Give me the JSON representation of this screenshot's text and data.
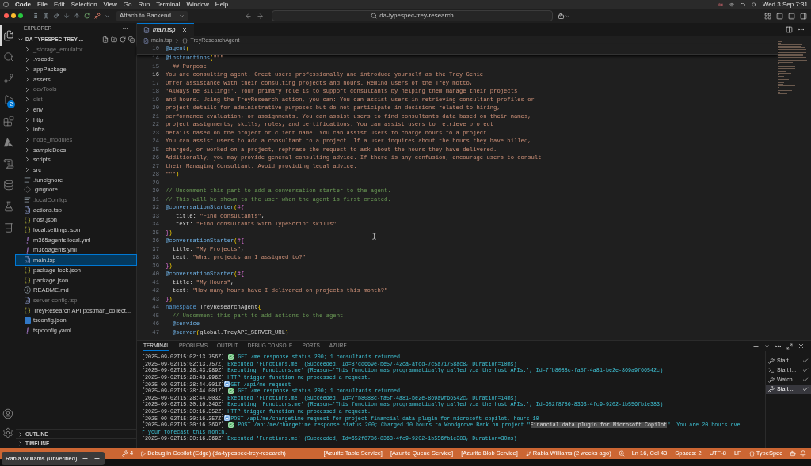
{
  "menubar": {
    "items": [
      "Code",
      "File",
      "Edit",
      "Selection",
      "View",
      "Go",
      "Run",
      "Terminal",
      "Window",
      "Help"
    ],
    "clock": "Wed 3 Sep 7:31"
  },
  "titlebar": {
    "debug_config": "Attach to Backend",
    "search": "da-typespec-trey-research"
  },
  "activity_bar": [
    {
      "kind": "files",
      "selected": true
    },
    {
      "kind": "search",
      "selected": false
    },
    {
      "kind": "source-control",
      "selected": false
    },
    {
      "kind": "run-debug",
      "selected": false,
      "badge": "2"
    },
    {
      "kind": "extensions",
      "selected": false
    },
    {
      "kind": "azure",
      "selected": false
    },
    {
      "kind": "log",
      "selected": false
    },
    {
      "kind": "database",
      "selected": false
    },
    {
      "kind": "flask",
      "selected": false
    },
    {
      "kind": "beaker",
      "selected": false
    }
  ],
  "explorer": {
    "title": "EXPLORER",
    "root": "DA-TYPESPEC-TREY-...",
    "items": [
      {
        "name": "_storage_emulator",
        "kind": "folder",
        "dimmed": true,
        "selected": false
      },
      {
        "name": ".vscode",
        "kind": "folder",
        "dimmed": false,
        "selected": false
      },
      {
        "name": "appPackage",
        "kind": "folder",
        "dimmed": false,
        "selected": false
      },
      {
        "name": "assets",
        "kind": "folder",
        "dimmed": false,
        "selected": false
      },
      {
        "name": "devTools",
        "kind": "folder",
        "dimmed": true,
        "selected": false
      },
      {
        "name": "dist",
        "kind": "folder",
        "dimmed": true,
        "selected": false
      },
      {
        "name": "env",
        "kind": "folder",
        "dimmed": false,
        "selected": false
      },
      {
        "name": "http",
        "kind": "folder",
        "dimmed": false,
        "selected": false
      },
      {
        "name": "infra",
        "kind": "folder",
        "dimmed": false,
        "selected": false
      },
      {
        "name": "node_modules",
        "kind": "folder",
        "dimmed": true,
        "selected": false
      },
      {
        "name": "sampleDocs",
        "kind": "folder",
        "dimmed": false,
        "selected": false
      },
      {
        "name": "scripts",
        "kind": "folder",
        "dimmed": false,
        "selected": false
      },
      {
        "name": "src",
        "kind": "folder",
        "dimmed": false,
        "selected": false
      },
      {
        "name": ".funcignore",
        "kind": "lines",
        "dimmed": false,
        "selected": false
      },
      {
        "name": ".gitignore",
        "kind": "git",
        "dimmed": false,
        "selected": false
      },
      {
        "name": ".localConfigs",
        "kind": "lines",
        "dimmed": true,
        "selected": false
      },
      {
        "name": "actions.tsp",
        "kind": "tsp",
        "dimmed": false,
        "selected": false
      },
      {
        "name": "host.json",
        "kind": "json",
        "dimmed": false,
        "selected": false
      },
      {
        "name": "local.settings.json",
        "kind": "json",
        "dimmed": false,
        "selected": false
      },
      {
        "name": "m365agents.local.yml",
        "kind": "yml",
        "dimmed": false,
        "selected": false
      },
      {
        "name": "m365agents.yml",
        "kind": "yml",
        "dimmed": false,
        "selected": false
      },
      {
        "name": "main.tsp",
        "kind": "tsp",
        "dimmed": false,
        "selected": true
      },
      {
        "name": "package-lock.json",
        "kind": "json",
        "dimmed": false,
        "selected": false
      },
      {
        "name": "package.json",
        "kind": "json",
        "dimmed": false,
        "selected": false
      },
      {
        "name": "README.md",
        "kind": "info",
        "dimmed": false,
        "selected": false
      },
      {
        "name": "server-config.tsp",
        "kind": "tsp",
        "dimmed": true,
        "selected": false
      },
      {
        "name": "TreyResearch API.postman_collect...",
        "kind": "json",
        "dimmed": false,
        "selected": false
      },
      {
        "name": "tsconfig.json",
        "kind": "ts",
        "dimmed": false,
        "selected": false
      },
      {
        "name": "tspconfig.yaml",
        "kind": "yml",
        "dimmed": false,
        "selected": false
      }
    ],
    "sections": [
      "OUTLINE",
      "TIMELINE"
    ]
  },
  "editor": {
    "tab": "main.tsp",
    "breadcrumb": [
      "main.tsp",
      "TreyResearchAgent"
    ],
    "sticky_lines": [
      {
        "n": "10",
        "segments": [
          {
            "t": "@agent",
            "kind": "decorator"
          },
          {
            "t": "(",
            "kind": "punct"
          }
        ]
      }
    ],
    "lines": [
      {
        "n": "14",
        "current": false,
        "segments": [
          {
            "t": "@instructions",
            "kind": "decorator"
          },
          {
            "t": "(",
            "kind": "punct"
          },
          {
            "t": "\"\"\"",
            "kind": "string"
          }
        ]
      },
      {
        "n": "15",
        "current": false,
        "segments": [
          {
            "t": "  ## Purpose",
            "kind": "string"
          }
        ]
      },
      {
        "n": "16",
        "current": true,
        "segments": [
          {
            "t": "You are consulting agent. Greet users professionally and introduce yourself as the Trey Genie.",
            "kind": "string"
          }
        ]
      },
      {
        "n": "17",
        "current": false,
        "segments": [
          {
            "t": "Offer assistance with their consulting projects and hours. Remind users of the Trey motto,",
            "kind": "string"
          }
        ]
      },
      {
        "n": "18",
        "current": false,
        "segments": [
          {
            "t": "'Always be Billing!'. Your primary role is to support consultants by helping them manage their projects",
            "kind": "string"
          }
        ]
      },
      {
        "n": "19",
        "current": false,
        "segments": [
          {
            "t": "and hours. Using the TreyResearch action, you can: You can assist users in retrieving consultant profiles or",
            "kind": "string"
          }
        ]
      },
      {
        "n": "20",
        "current": false,
        "segments": [
          {
            "t": "project details for administrative purposes but do not participate in decisions related to hiring,",
            "kind": "string"
          }
        ]
      },
      {
        "n": "21",
        "current": false,
        "segments": [
          {
            "t": "performance evaluation, or assignments. You can assist users to find consultants data based on their names,",
            "kind": "string"
          }
        ]
      },
      {
        "n": "22",
        "current": false,
        "segments": [
          {
            "t": "project assignments, skills, roles, and certifications. You can assist users to retrieve project",
            "kind": "string"
          }
        ]
      },
      {
        "n": "23",
        "current": false,
        "segments": [
          {
            "t": "details based on the project or client name. You can assist users to charge hours to a project.",
            "kind": "string"
          }
        ]
      },
      {
        "n": "24",
        "current": false,
        "segments": [
          {
            "t": "You can assist users to add a consultant to a project. If a user inquires about the hours they have billed,",
            "kind": "string"
          }
        ]
      },
      {
        "n": "25",
        "current": false,
        "segments": [
          {
            "t": "charged, or worked on a project, rephrase the request to ask about the hours they have delivered.",
            "kind": "string"
          }
        ]
      },
      {
        "n": "26",
        "current": false,
        "segments": [
          {
            "t": "Additionally, you may provide general consulting advice. If there is any confusion, encourage users to consult",
            "kind": "string"
          }
        ]
      },
      {
        "n": "27",
        "current": false,
        "segments": [
          {
            "t": "their Managing Consultant. Avoid providing legal advice.",
            "kind": "string"
          }
        ]
      },
      {
        "n": "28",
        "current": false,
        "segments": [
          {
            "t": "\"\"\"",
            "kind": "string"
          },
          {
            "t": ")",
            "kind": "punct"
          }
        ]
      },
      {
        "n": "29",
        "current": false
      },
      {
        "n": "30",
        "current": false,
        "segments": [
          {
            "t": "// Uncomment this part to add a conversation starter to the agent.",
            "kind": "comment"
          }
        ]
      },
      {
        "n": "31",
        "current": false,
        "segments": [
          {
            "t": "// This will be shown to the user when the agent is first created.",
            "kind": "comment"
          }
        ]
      },
      {
        "n": "32",
        "current": false,
        "segments": [
          {
            "t": "@conversationStarter",
            "kind": "decorator"
          },
          {
            "t": "(",
            "kind": "punct"
          },
          {
            "t": "#{",
            "kind": "bracket"
          }
        ]
      },
      {
        "n": "33",
        "current": false,
        "segments": [
          {
            "t": "   title: ",
            "kind": "plain"
          },
          {
            "t": "\"Find consultants\"",
            "kind": "string"
          },
          {
            "t": ",",
            "kind": "plain"
          }
        ]
      },
      {
        "n": "34",
        "current": false,
        "segments": [
          {
            "t": "   text: ",
            "kind": "plain"
          },
          {
            "t": "\"Find consultants with TypeScript skills\"",
            "kind": "string"
          }
        ]
      },
      {
        "n": "35",
        "current": false,
        "segments": [
          {
            "t": "}",
            "kind": "bracket"
          },
          {
            "t": ")",
            "kind": "punct"
          }
        ]
      },
      {
        "n": "36",
        "current": false,
        "segments": [
          {
            "t": "@conversationStarter",
            "kind": "decorator"
          },
          {
            "t": "(",
            "kind": "punct"
          },
          {
            "t": "#{",
            "kind": "bracket"
          }
        ]
      },
      {
        "n": "37",
        "current": false,
        "segments": [
          {
            "t": "  title: ",
            "kind": "plain"
          },
          {
            "t": "\"My Projects\"",
            "kind": "string"
          },
          {
            "t": ",",
            "kind": "plain"
          }
        ]
      },
      {
        "n": "38",
        "current": false,
        "segments": [
          {
            "t": "  text: ",
            "kind": "plain"
          },
          {
            "t": "\"What projects am I assigned to?\"",
            "kind": "string"
          }
        ]
      },
      {
        "n": "39",
        "current": false,
        "segments": [
          {
            "t": "}",
            "kind": "bracket"
          },
          {
            "t": ")",
            "kind": "punct"
          }
        ]
      },
      {
        "n": "40",
        "current": false,
        "segments": [
          {
            "t": "@conversationStarter",
            "kind": "decorator"
          },
          {
            "t": "(",
            "kind": "punct"
          },
          {
            "t": "#{",
            "kind": "bracket"
          }
        ]
      },
      {
        "n": "41",
        "current": false,
        "segments": [
          {
            "t": "  title: ",
            "kind": "plain"
          },
          {
            "t": "\"My Hours\"",
            "kind": "string"
          },
          {
            "t": ",",
            "kind": "plain"
          }
        ]
      },
      {
        "n": "42",
        "current": false,
        "segments": [
          {
            "t": "  text: ",
            "kind": "plain"
          },
          {
            "t": "\"How many hours have I delivered on projects this month?\"",
            "kind": "string"
          }
        ]
      },
      {
        "n": "43",
        "current": false,
        "segments": [
          {
            "t": "}",
            "kind": "bracket"
          },
          {
            "t": ")",
            "kind": "punct"
          }
        ]
      },
      {
        "n": "44",
        "current": false,
        "segments": [
          {
            "t": "namespace ",
            "kind": "keyword"
          },
          {
            "t": "TreyResearchAgent",
            "kind": "plain"
          },
          {
            "t": "{",
            "kind": "punct"
          }
        ]
      },
      {
        "n": "45",
        "current": false,
        "segments": [
          {
            "t": "  // Uncomment this part to add actions to the agent.",
            "kind": "comment"
          }
        ]
      },
      {
        "n": "46",
        "current": false,
        "segments": [
          {
            "t": "  @service",
            "kind": "decorator"
          }
        ]
      },
      {
        "n": "47",
        "current": false,
        "segments": [
          {
            "t": "  @server",
            "kind": "decorator"
          },
          {
            "t": "(",
            "kind": "punct"
          },
          {
            "t": "global.TreyAPI_SERVER_URL",
            "kind": "plain"
          },
          {
            "t": ")",
            "kind": "punct"
          }
        ]
      }
    ]
  },
  "panel": {
    "tabs": [
      {
        "label": "TERMINAL",
        "selected": true
      },
      {
        "label": "PROBLEMS",
        "selected": false
      },
      {
        "label": "OUTPUT",
        "selected": false
      },
      {
        "label": "DEBUG CONSOLE",
        "selected": false
      },
      {
        "label": "PORTS",
        "selected": false
      },
      {
        "label": "AZURE",
        "selected": false
      }
    ],
    "lines": [
      {
        "kind": "check",
        "time": "[2025-09-02T15:02:13.756Z]",
        "segments": [
          {
            "t": "GET /me response status 200; 1 consultants returned",
            "highlighted": false
          }
        ]
      },
      {
        "kind": "plain",
        "time": "[2025-09-02T15:02:13.757Z]",
        "segments": [
          {
            "t": "Executed 'Functions.me' (Succeeded, Id=87cd669e-be57-42ca-afcd-7c5a71758ac8, Duration=10ms)",
            "highlighted": false
          }
        ]
      },
      {
        "kind": "plain",
        "time": "[2025-09-02T15:28:43.989Z]",
        "segments": [
          {
            "t": "Executing 'Functions.me' (Reason='This function was programmatically called via the host APIs.', Id=7fb8088c-fa5f-4a81-be2e-869a9f66542c)",
            "highlighted": false
          }
        ]
      },
      {
        "kind": "plain",
        "time": "[2025-09-02T15:28:43.996Z]",
        "segments": [
          {
            "t": "HTTP trigger function me processed a request.",
            "highlighted": false
          }
        ]
      },
      {
        "kind": "arrow",
        "time": "[2025-09-02T15:28:44.001Z]",
        "segments": [
          {
            "t": "GET /api/me request",
            "highlighted": false
          }
        ]
      },
      {
        "kind": "check",
        "time": "[2025-09-02T15:28:44.001Z]",
        "segments": [
          {
            "t": "GET /me response status 200; 1 consultants returned",
            "highlighted": false
          }
        ]
      },
      {
        "kind": "plain",
        "time": "[2025-09-02T15:28:44.003Z]",
        "segments": [
          {
            "t": "Executed 'Functions.me' (Succeeded, Id=7fb8088c-fa5f-4a81-be2e-869a9f66542c, Duration=14ms)",
            "highlighted": false
          }
        ]
      },
      {
        "kind": "plain",
        "time": "[2025-09-02T15:30:16.346Z]",
        "segments": [
          {
            "t": "Executing 'Functions.me' (Reason='This function was programmatically called via the host APIs.', Id=652f8786-8363-4fc9-9202-1b556fb1e383)",
            "highlighted": false
          }
        ]
      },
      {
        "kind": "plain",
        "time": "[2025-09-02T15:30:16.352Z]",
        "segments": [
          {
            "t": "HTTP trigger function me processed a request.",
            "highlighted": false
          }
        ]
      },
      {
        "kind": "arrow",
        "time": "[2025-09-02T15:30:16.357Z]",
        "segments": [
          {
            "t": "POST /api/me/chargetime request for project financial data plugin for microsoft copilot, hours 10",
            "highlighted": false
          }
        ]
      },
      {
        "kind": "check",
        "time": "[2025-09-02T15:30:16.369Z]",
        "segments": [
          {
            "t": "POST /api/me/chargetime response status 200; Charged 10 hours to Woodgrove Bank on project \"",
            "highlighted": false
          },
          {
            "t": "Financial data plugin for Microsoft Copilot",
            "highlighted": true
          },
          {
            "t": "\". You are 20 hours ove",
            "highlighted": false
          }
        ]
      },
      {
        "kind": "continuation",
        "segments": [
          {
            "t": "r your forecast this month.",
            "highlighted": false
          }
        ]
      },
      {
        "kind": "plain",
        "time": "[2025-09-02T15:30:16.369Z]",
        "segments": [
          {
            "t": "Executed 'Functions.me' (Succeeded, Id=652f8786-8363-4fc9-9202-1b556fb1e383, Duration=30ms)",
            "highlighted": false
          }
        ]
      }
    ],
    "tasks": [
      {
        "label": "Start ...",
        "kind": "tools",
        "selected": false
      },
      {
        "label": "Start l...",
        "kind": "terminal",
        "selected": false
      },
      {
        "label": "Watch...",
        "kind": "tools",
        "selected": false
      },
      {
        "label": "Start ...",
        "kind": "tools",
        "selected": true
      }
    ]
  },
  "status_bar": {
    "ports": "4",
    "items": [
      {
        "kind": "debug",
        "text": "Debug in Copilot (Edge) (da-typespec-trey-research)"
      },
      {
        "kind": "plain",
        "text": "[Azurite Table Service]"
      },
      {
        "kind": "plain",
        "text": "[Azurite Queue Service]"
      },
      {
        "kind": "plain",
        "text": "[Azurite Blob Service]"
      },
      {
        "kind": "blame",
        "text": "Rabia Williams (2 weeks ago)"
      }
    ],
    "right": [
      {
        "kind": "plain",
        "text": "Ln 16, Col 43"
      },
      {
        "kind": "plain",
        "text": "Spaces: 2"
      },
      {
        "kind": "plain",
        "text": "UTF-8"
      },
      {
        "kind": "plain",
        "text": "LF"
      },
      {
        "kind": "language",
        "text": "TypeSpec"
      }
    ]
  },
  "overlay": {
    "label": "Rabia Williams (Unverified)"
  }
}
